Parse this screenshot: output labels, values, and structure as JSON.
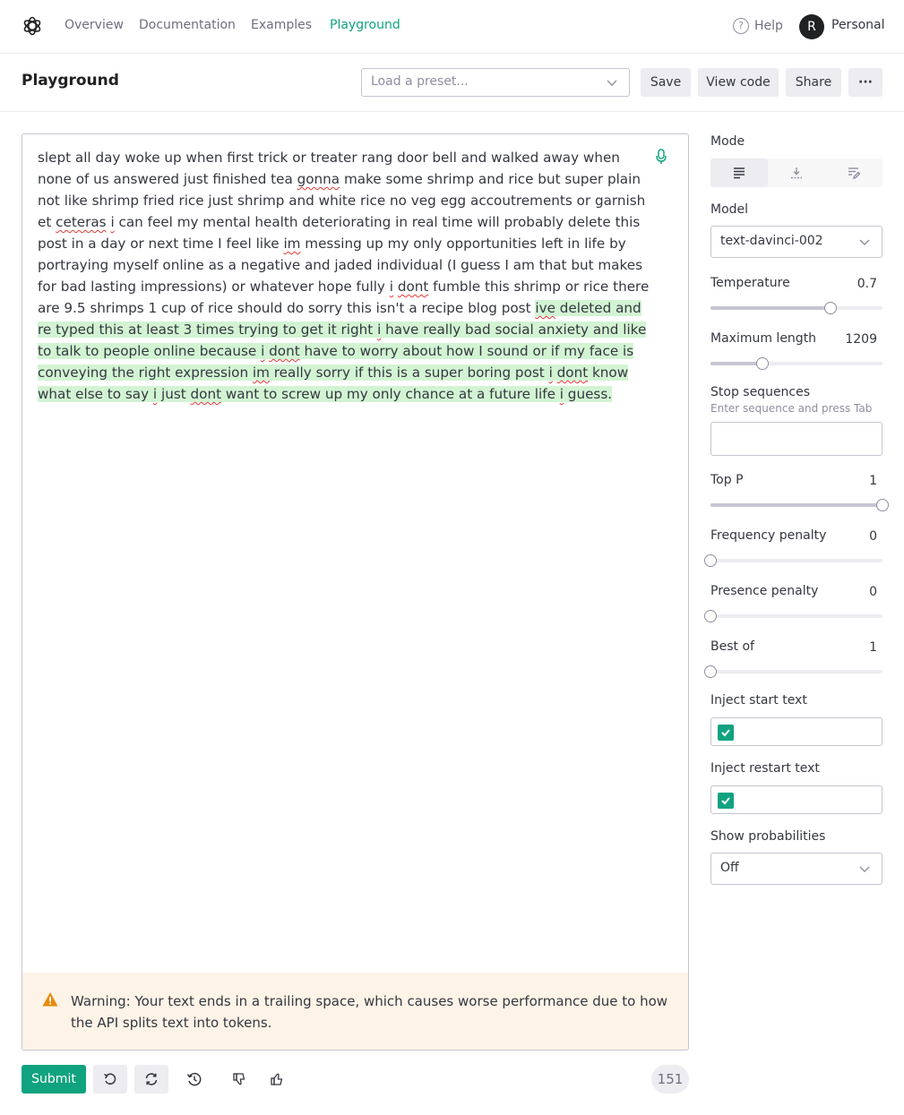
{
  "nav": {
    "links": [
      "Overview",
      "Documentation",
      "Examples",
      "Playground"
    ],
    "help": "Help",
    "avatar_initial": "R",
    "account": "Personal"
  },
  "header": {
    "title": "Playground",
    "preset_placeholder": "Load a preset...",
    "save": "Save",
    "view_code": "View code",
    "share": "Share",
    "more": "···"
  },
  "editor": {
    "segments": [
      {
        "t": "slept all day woke up when first trick or treater rang door bell and walked away when none of us answered just finished tea ",
        "s": "n"
      },
      {
        "t": "gonna",
        "s": "q"
      },
      {
        "t": " make some shrimp and rice but super plain not like shrimp fried rice just shrimp and white rice no veg egg accoutrements or garnish et ",
        "s": "n"
      },
      {
        "t": "ceteras",
        "s": "q"
      },
      {
        "t": " ",
        "s": "n"
      },
      {
        "t": "i",
        "s": "q"
      },
      {
        "t": " can feel my mental health deteriorating in real time will probably delete this post in a day or next time I feel like ",
        "s": "n"
      },
      {
        "t": "im",
        "s": "q"
      },
      {
        "t": " messing up my only opportunities left in life by portraying myself online as a negative and jaded individual (I guess I am that but makes for bad lasting impressions) or whatever hope fully ",
        "s": "n"
      },
      {
        "t": "i",
        "s": "q"
      },
      {
        "t": " ",
        "s": "n"
      },
      {
        "t": "dont",
        "s": "q"
      },
      {
        "t": " fumble this shrimp or rice there are 9.5 shrimps 1 cup of rice should do sorry this isn't a recipe blog post ",
        "s": "n"
      },
      {
        "t": "ive",
        "s": "hq"
      },
      {
        "t": " deleted and re typed this at least 3 times trying to get it right ",
        "s": "h"
      },
      {
        "t": "i",
        "s": "hq"
      },
      {
        "t": " have really bad social anxiety and like to talk to people online because ",
        "s": "h"
      },
      {
        "t": "i",
        "s": "hq"
      },
      {
        "t": " ",
        "s": "h"
      },
      {
        "t": "dont",
        "s": "hq"
      },
      {
        "t": " have to worry about how I sound or if my face is conveying the right expression ",
        "s": "h"
      },
      {
        "t": "im",
        "s": "hq"
      },
      {
        "t": " really sorry if this is a super boring post ",
        "s": "h"
      },
      {
        "t": "i",
        "s": "hq"
      },
      {
        "t": " ",
        "s": "h"
      },
      {
        "t": "dont",
        "s": "hq"
      },
      {
        "t": " know what else to say ",
        "s": "h"
      },
      {
        "t": "i",
        "s": "hq"
      },
      {
        "t": " just ",
        "s": "h"
      },
      {
        "t": "dont",
        "s": "hq"
      },
      {
        "t": " want to screw up my only chance at a future life ",
        "s": "h"
      },
      {
        "t": "i",
        "s": "hq"
      },
      {
        "t": " guess.",
        "s": "h"
      }
    ],
    "warning": "Warning: Your text ends in a trailing space, which causes worse performance due to how the API splits text into tokens."
  },
  "actions": {
    "submit": "Submit",
    "token_count": "151"
  },
  "sidebar": {
    "mode_label": "Mode",
    "model_label": "Model",
    "model_value": "text-davinci-002",
    "temperature": {
      "label": "Temperature",
      "value": "0.7",
      "fraction": 0.7
    },
    "max_length": {
      "label": "Maximum length",
      "value": "1209",
      "fraction": 0.3
    },
    "stop_label": "Stop sequences",
    "stop_hint": "Enter sequence and press Tab",
    "top_p": {
      "label": "Top P",
      "value": "1",
      "fraction": 1.0
    },
    "frequency_penalty": {
      "label": "Frequency penalty",
      "value": "0",
      "fraction": 0.0
    },
    "presence_penalty": {
      "label": "Presence penalty",
      "value": "0",
      "fraction": 0.0
    },
    "best_of": {
      "label": "Best of",
      "value": "1",
      "fraction": 0.0
    },
    "inject_start_label": "Inject start text",
    "inject_start_checked": true,
    "inject_restart_label": "Inject restart text",
    "inject_restart_checked": true,
    "probabilities_label": "Show probabilities",
    "probabilities_value": "Off"
  },
  "colors": {
    "accent": "#10a37f",
    "highlight": "#d2f4d3",
    "warning_bg": "#fdf3e7",
    "warning_icon": "#e8890c"
  }
}
